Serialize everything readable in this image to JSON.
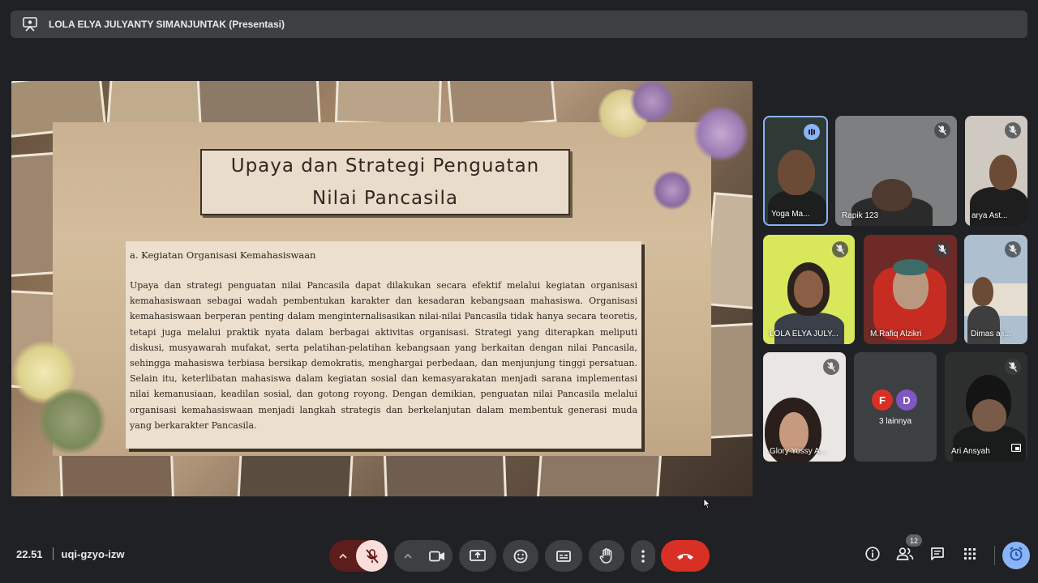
{
  "presenter_bar": {
    "title": "LOLA ELYA JULYANTY SIMANJUNTAK (Presentasi)"
  },
  "slide": {
    "title_line1": "Upaya dan Strategi Penguatan",
    "title_line2": "Nilai Pancasila",
    "heading": "a. Kegiatan Organisasi Kemahasiswaan",
    "paragraph": "Upaya dan strategi penguatan nilai Pancasila dapat dilakukan secara efektif melalui kegiatan organisasi kemahasiswaan sebagai wadah pembentukan karakter dan kesadaran kebangsaan mahasiswa. Organisasi kemahasiswaan berperan penting dalam menginternalisasikan nilai-nilai Pancasila tidak hanya secara teoretis, tetapi juga melalui praktik nyata dalam berbagai aktivitas organisasi. Strategi yang diterapkan meliputi diskusi, musyawarah mufakat, serta pelatihan-pelatihan kebangsaan yang berkaitan dengan nilai Pancasila, sehingga mahasiswa terbiasa bersikap demokratis, menghargai perbedaan, dan menjunjung tinggi persatuan. Selain itu, keterlibatan mahasiswa dalam kegiatan sosial dan kemasyarakatan menjadi sarana implementasi nilai kemanusiaan, keadilan sosial, dan gotong royong. Dengan demikian, penguatan nilai Pancasila melalui organisasi kemahasiswaan menjadi langkah strategis dan berkelanjutan dalam membentuk generasi muda yang berkarakter Pancasila."
  },
  "participants": [
    {
      "name": "Yoga Ma...",
      "status": "speaking"
    },
    {
      "name": "Rapik 123",
      "status": "muted"
    },
    {
      "name": "arya Ast...",
      "status": "muted"
    },
    {
      "name": "LOLA ELYA JULY...",
      "status": "muted"
    },
    {
      "name": "M.Rafiq Alzikri",
      "status": "muted"
    },
    {
      "name": "Dimas aji...",
      "status": "muted"
    },
    {
      "name": "Glory Yossy A...",
      "status": "muted"
    },
    {
      "name": "3 lainnya",
      "avatars": [
        "F",
        "D"
      ],
      "avatar_colors": [
        "#d93025",
        "#7e57c2"
      ]
    },
    {
      "name": "Ari Ansyah",
      "status": "muted"
    }
  ],
  "meeting": {
    "time": "22.51",
    "code": "uqi-gzyo-izw"
  },
  "controls": {
    "participants_count": "12",
    "end_call_color": "#d93025",
    "mic_off_color": "#f9dedc"
  },
  "icons": [
    "presentation-icon",
    "mic-off-icon",
    "camera-icon",
    "present-screen-icon",
    "emoji-icon",
    "captions-icon",
    "raise-hand-icon",
    "more-options-icon",
    "end-call-icon",
    "info-icon",
    "people-icon",
    "chat-icon",
    "activities-icon",
    "timer-icon"
  ]
}
